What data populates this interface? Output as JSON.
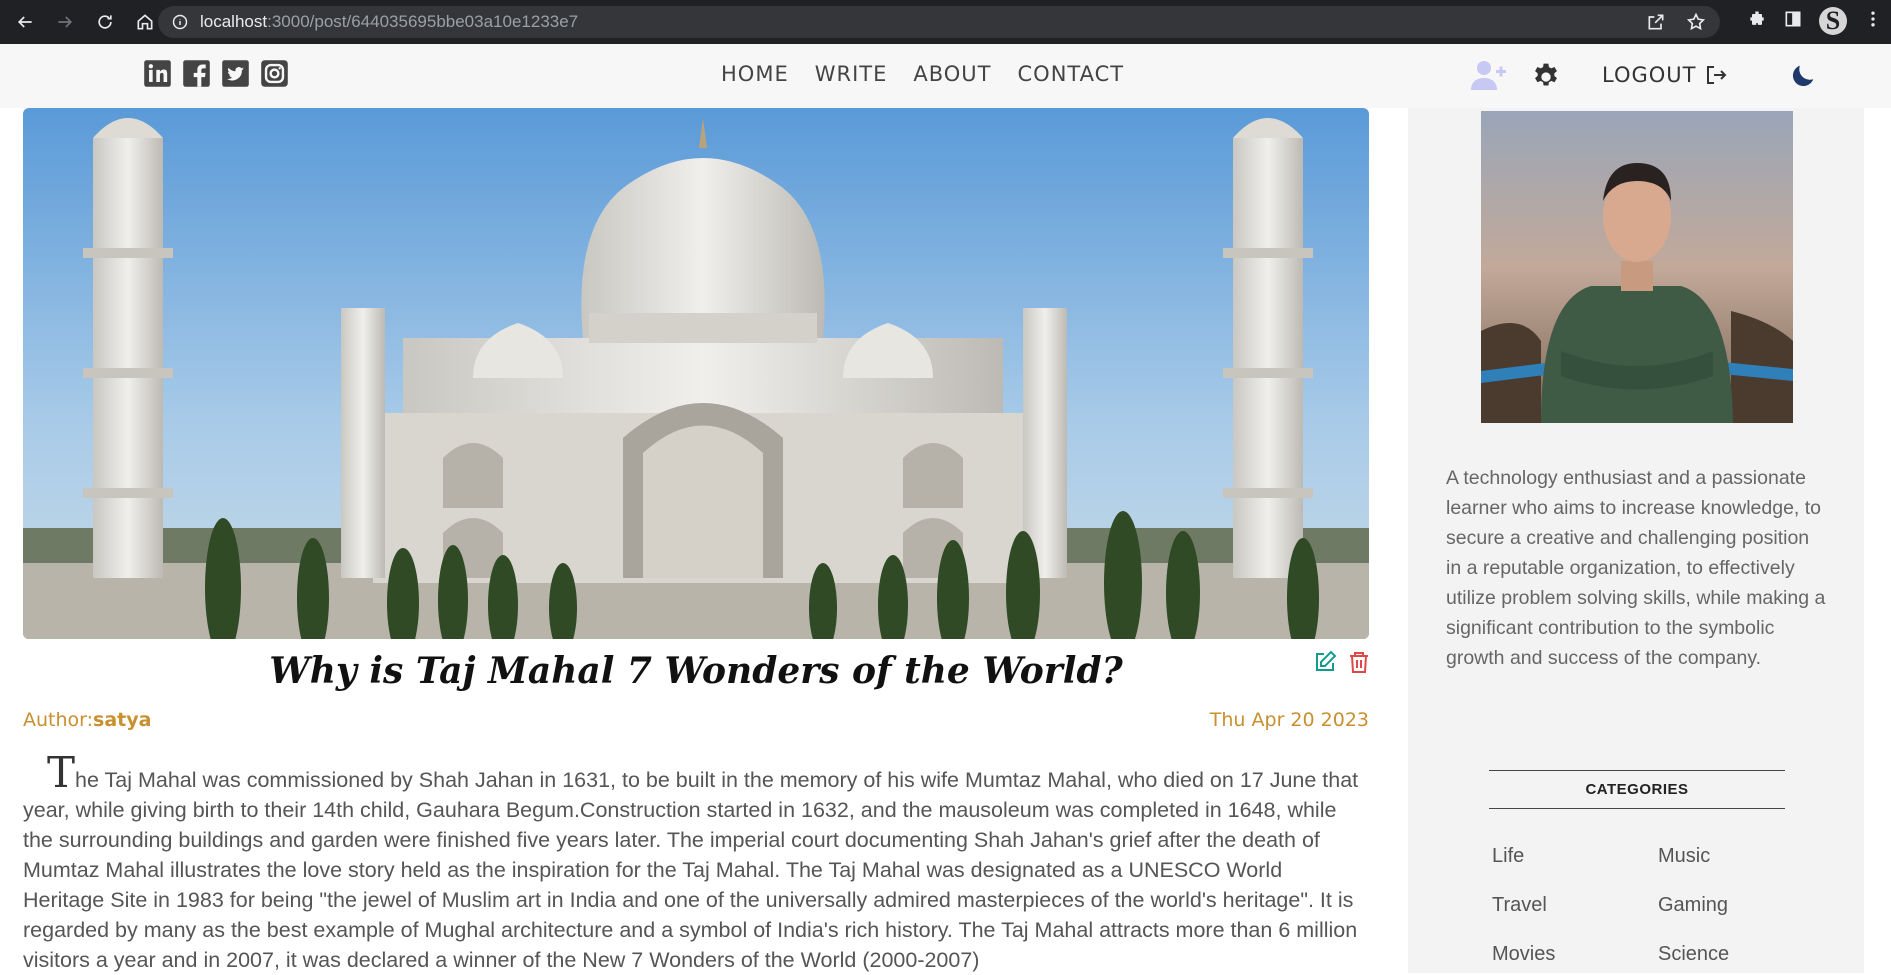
{
  "browser": {
    "url_host": "localhost",
    "url_path": ":3000/post/644035695bbe03a10e1233e7",
    "profile_initial": "S"
  },
  "header": {
    "social_icons": [
      "linkedin-icon",
      "facebook-icon",
      "twitter-icon",
      "instagram-icon"
    ],
    "menu": [
      "HOME",
      "WRITE",
      "ABOUT",
      "CONTACT"
    ],
    "logout_label": "LOGOUT"
  },
  "post": {
    "title": "Why is Taj Mahal 7 Wonders of the World?",
    "author_prefix": "Author:",
    "author_name": "satya",
    "date": "Thu Apr 20 2023",
    "dropcap": "T",
    "body": "he Taj Mahal was commissioned by Shah Jahan in 1631, to be built in the memory of his wife Mumtaz Mahal, who died on 17 June that year, while giving birth to their 14th child, Gauhara Begum.Construction started in 1632, and the mausoleum was completed in 1648, while the surrounding buildings and garden were finished five years later. The imperial court documenting Shah Jahan's grief after the death of Mumtaz Mahal illustrates the love story held as the inspiration for the Taj Mahal. The Taj Mahal was designated as a UNESCO World Heritage Site in 1983 for being \"the jewel of Muslim art in India and one of the universally admired masterpieces of the world's heritage\". It is regarded by many as the best example of Mughal architecture and a symbol of India's rich history. The Taj Mahal attracts more than 6 million visitors a year and in 2007, it was declared a winner of the New 7 Wonders of the World (2000-2007)"
  },
  "sidebar": {
    "bio": "A technology enthusiast and a passionate learner who aims to increase knowledge, to secure a creative and challenging position in a reputable organization, to effectively utilize problem solving skills, while making a significant contribution to the symbolic growth and success of the company.",
    "categories_title": "CATEGORIES",
    "categories": [
      "Life",
      "Music",
      "Travel",
      "Gaming",
      "Movies",
      "Science"
    ]
  },
  "colors": {
    "accent_meta": "#c8902e",
    "edit": "#139c8a",
    "delete": "#e04848",
    "moon": "#1f3a6a"
  }
}
